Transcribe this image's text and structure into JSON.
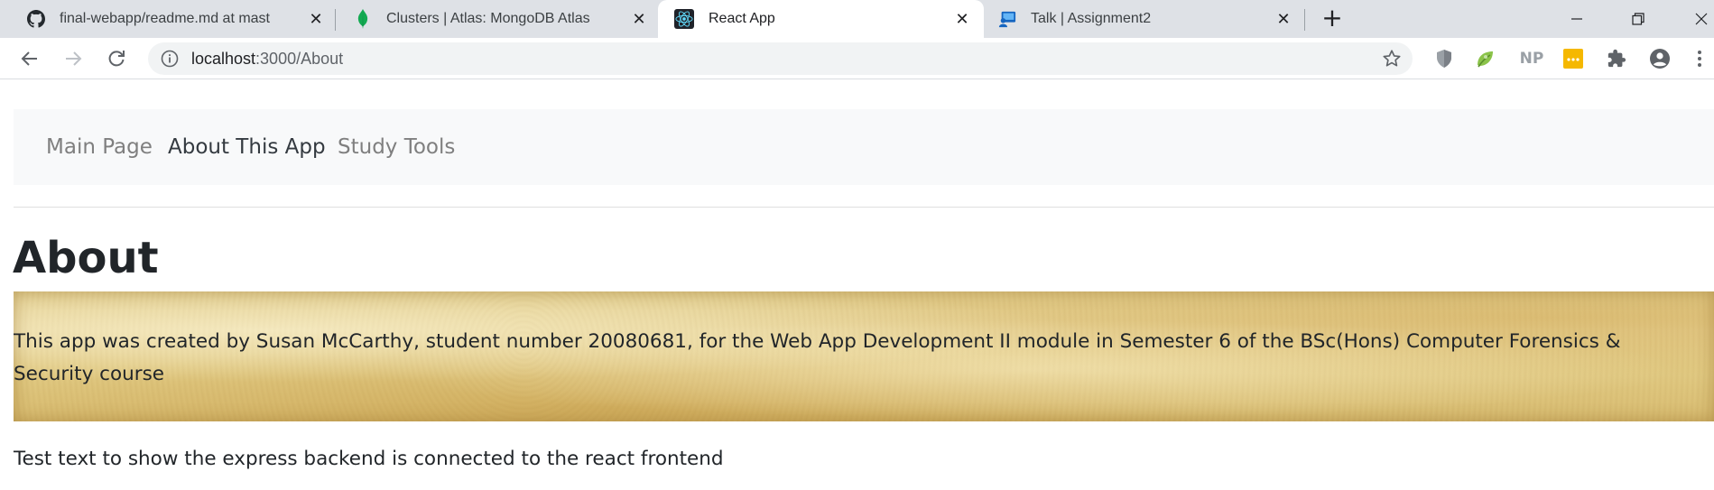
{
  "browser": {
    "tabs": [
      {
        "title": "final-webapp/readme.md at mast",
        "icon": "github-icon",
        "active": false
      },
      {
        "title": "Clusters | Atlas: MongoDB Atlas",
        "icon": "mongodb-leaf-icon",
        "active": false
      },
      {
        "title": "React App",
        "icon": "react-icon",
        "active": true
      },
      {
        "title": "Talk | Assignment2",
        "icon": "talk-icon",
        "active": false
      }
    ],
    "url": {
      "host": "localhost",
      "path": ":3000/About"
    },
    "extensions": [
      "shield-extension-icon",
      "leaf-extension-icon",
      "np-extension-icon",
      "password-extension-icon",
      "puzzle-extensions-icon",
      "profile-avatar-icon"
    ],
    "np_label": "NP"
  },
  "nav": {
    "links": [
      {
        "label": "Main Page",
        "active": false
      },
      {
        "label": "About This App",
        "active": true
      },
      {
        "label": "Study Tools",
        "active": false
      }
    ]
  },
  "page": {
    "title": "About",
    "about_text": "This app was created by Susan McCarthy, student number 20080681, for the Web App Development II module in Semester 6 of the BSc(Hons) Computer Forensics & Security course",
    "backend_text": "Test text to show the express backend is connected to the react frontend"
  },
  "colors": {
    "tabstrip": "#dee1e6",
    "navbar_bg": "#f8f9fa",
    "nav_inactive": "#7f7f7f",
    "nav_active": "#343a40",
    "text": "#212529"
  }
}
